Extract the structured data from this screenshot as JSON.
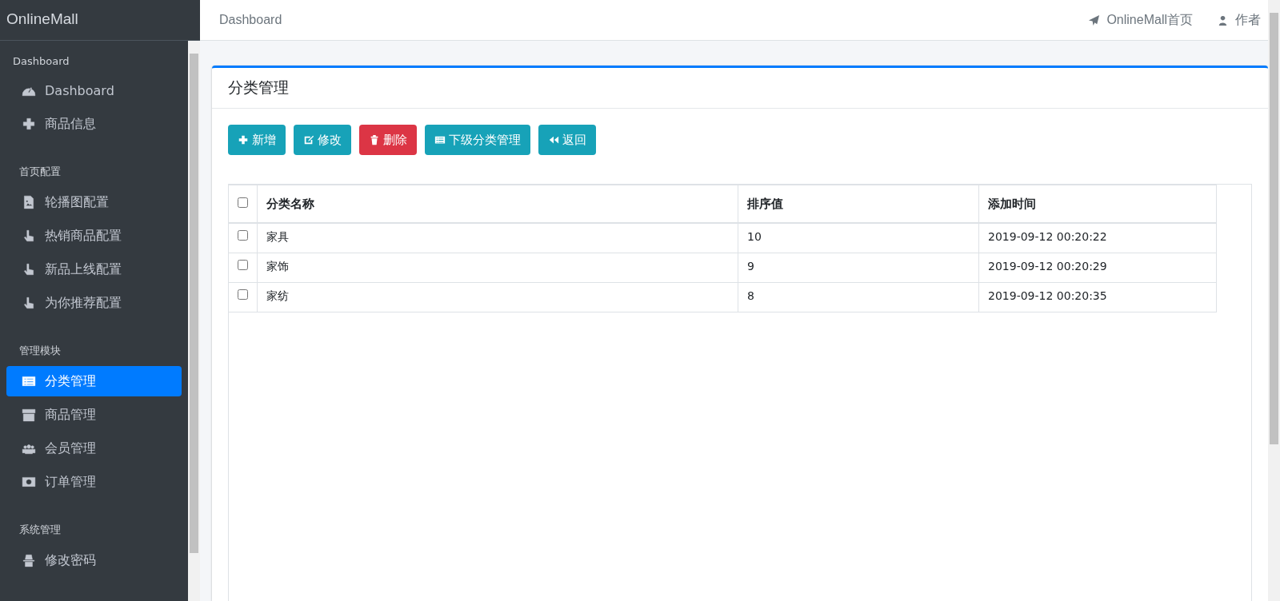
{
  "brand": "OnlineMall",
  "sidebar": {
    "groups": [
      {
        "header": "Dashboard",
        "items": [
          {
            "label": "Dashboard",
            "kind": "gauge",
            "selected": false
          },
          {
            "label": "商品信息",
            "kind": "plus",
            "selected": false
          }
        ]
      },
      {
        "header": "首页配置",
        "items": [
          {
            "label": "轮播图配置",
            "kind": "image",
            "selected": false
          },
          {
            "label": "热销商品配置",
            "kind": "hand",
            "selected": false
          },
          {
            "label": "新品上线配置",
            "kind": "hand",
            "selected": false
          },
          {
            "label": "为你推荐配置",
            "kind": "hand",
            "selected": false
          }
        ]
      },
      {
        "header": "管理模块",
        "items": [
          {
            "label": "分类管理",
            "kind": "list",
            "selected": true
          },
          {
            "label": "商品管理",
            "kind": "archive",
            "selected": false
          },
          {
            "label": "会员管理",
            "kind": "users",
            "selected": false
          },
          {
            "label": "订单管理",
            "kind": "money",
            "selected": false
          }
        ]
      },
      {
        "header": "系统管理",
        "items": [
          {
            "label": "修改密码",
            "kind": "spy",
            "selected": false
          }
        ]
      }
    ]
  },
  "navbar": {
    "breadcrumb": "Dashboard",
    "links": [
      {
        "label": "OnlineMall首页",
        "kind": "plane"
      },
      {
        "label": "作者",
        "kind": "user"
      }
    ]
  },
  "card": {
    "title": "分类管理",
    "buttons": [
      {
        "label": "新增",
        "kind": "plus"
      },
      {
        "label": "修改",
        "kind": "edit"
      },
      {
        "label": "删除",
        "kind": "trash"
      },
      {
        "label": "下级分类管理",
        "kind": "list"
      },
      {
        "label": "返回",
        "kind": "back"
      }
    ],
    "table": {
      "header_checked": false,
      "columns": [
        "分类名称",
        "排序值",
        "添加时间"
      ],
      "rows": [
        {
          "checked": false,
          "cells": [
            "家具",
            "10",
            "2019-09-12 00:20:22"
          ]
        },
        {
          "checked": false,
          "cells": [
            "家饰",
            "9",
            "2019-09-12 00:20:29"
          ]
        },
        {
          "checked": false,
          "cells": [
            "家纺",
            "8",
            "2019-09-12 00:20:35"
          ]
        }
      ]
    }
  }
}
